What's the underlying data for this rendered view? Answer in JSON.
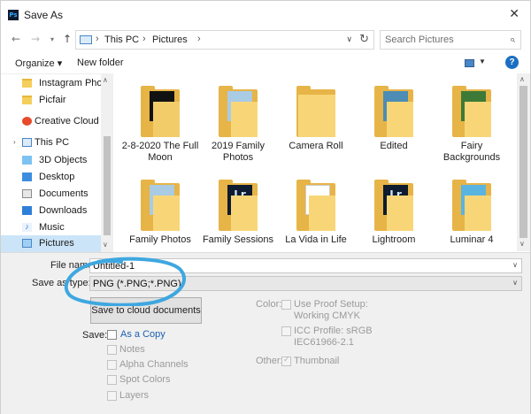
{
  "window": {
    "title": "Save As",
    "app_icon_text": "Ps"
  },
  "address": {
    "crumbs": [
      "This PC",
      "Pictures"
    ],
    "search_placeholder": "Search Pictures"
  },
  "toolbar": {
    "organize": "Organize ▾",
    "new_folder": "New folder"
  },
  "nav": {
    "items": [
      {
        "label": "Instagram Photo",
        "icon": "folder-icon"
      },
      {
        "label": "Picfair",
        "icon": "folder-icon"
      },
      {
        "label": "Creative Cloud File",
        "icon": "creative-cloud-icon"
      },
      {
        "label": "This PC",
        "icon": "pc-icon"
      },
      {
        "label": "3D Objects",
        "icon": "3d-objects-icon"
      },
      {
        "label": "Desktop",
        "icon": "desktop-icon"
      },
      {
        "label": "Documents",
        "icon": "documents-icon"
      },
      {
        "label": "Downloads",
        "icon": "downloads-icon"
      },
      {
        "label": "Music",
        "icon": "music-icon"
      },
      {
        "label": "Pictures",
        "icon": "pictures-icon"
      }
    ]
  },
  "folders": [
    {
      "label": "2-8-2020 The Full Moon",
      "style": "black"
    },
    {
      "label": "2019 Family Photos",
      "style": "doc"
    },
    {
      "label": "Camera Roll",
      "style": "plain"
    },
    {
      "label": "Edited",
      "style": "photo"
    },
    {
      "label": "Fairy Backgrounds",
      "style": "green"
    },
    {
      "label": "Family Photos",
      "style": "doc"
    },
    {
      "label": "Family Sessions",
      "style": "lr"
    },
    {
      "label": "La Vida in Life",
      "style": "doc"
    },
    {
      "label": "Lightroom",
      "style": "lr"
    },
    {
      "label": "Luminar 4",
      "style": "lum"
    }
  ],
  "form": {
    "file_name_label": "File name:",
    "file_name_value": "Untitled-1",
    "save_type_label": "Save as type:",
    "save_type_value": "PNG (*.PNG;*.PNG)",
    "cloud_button": "Save to cloud documents",
    "save_label": "Save:",
    "as_copy": "As a Copy",
    "notes": "Notes",
    "alpha": "Alpha Channels",
    "spot": "Spot Colors",
    "layers": "Layers",
    "color_label": "Color:",
    "proof_line1": "Use Proof Setup:",
    "proof_line2": "Working CMYK",
    "icc_line1": "ICC Profile:  sRGB",
    "icc_line2": "IEC61966-2.1",
    "other_label": "Other:",
    "thumbnail": "Thumbnail"
  },
  "colors": {
    "annotation": "#3ea7e0",
    "selection": "#cce4f7",
    "help": "#1b6fc2"
  }
}
